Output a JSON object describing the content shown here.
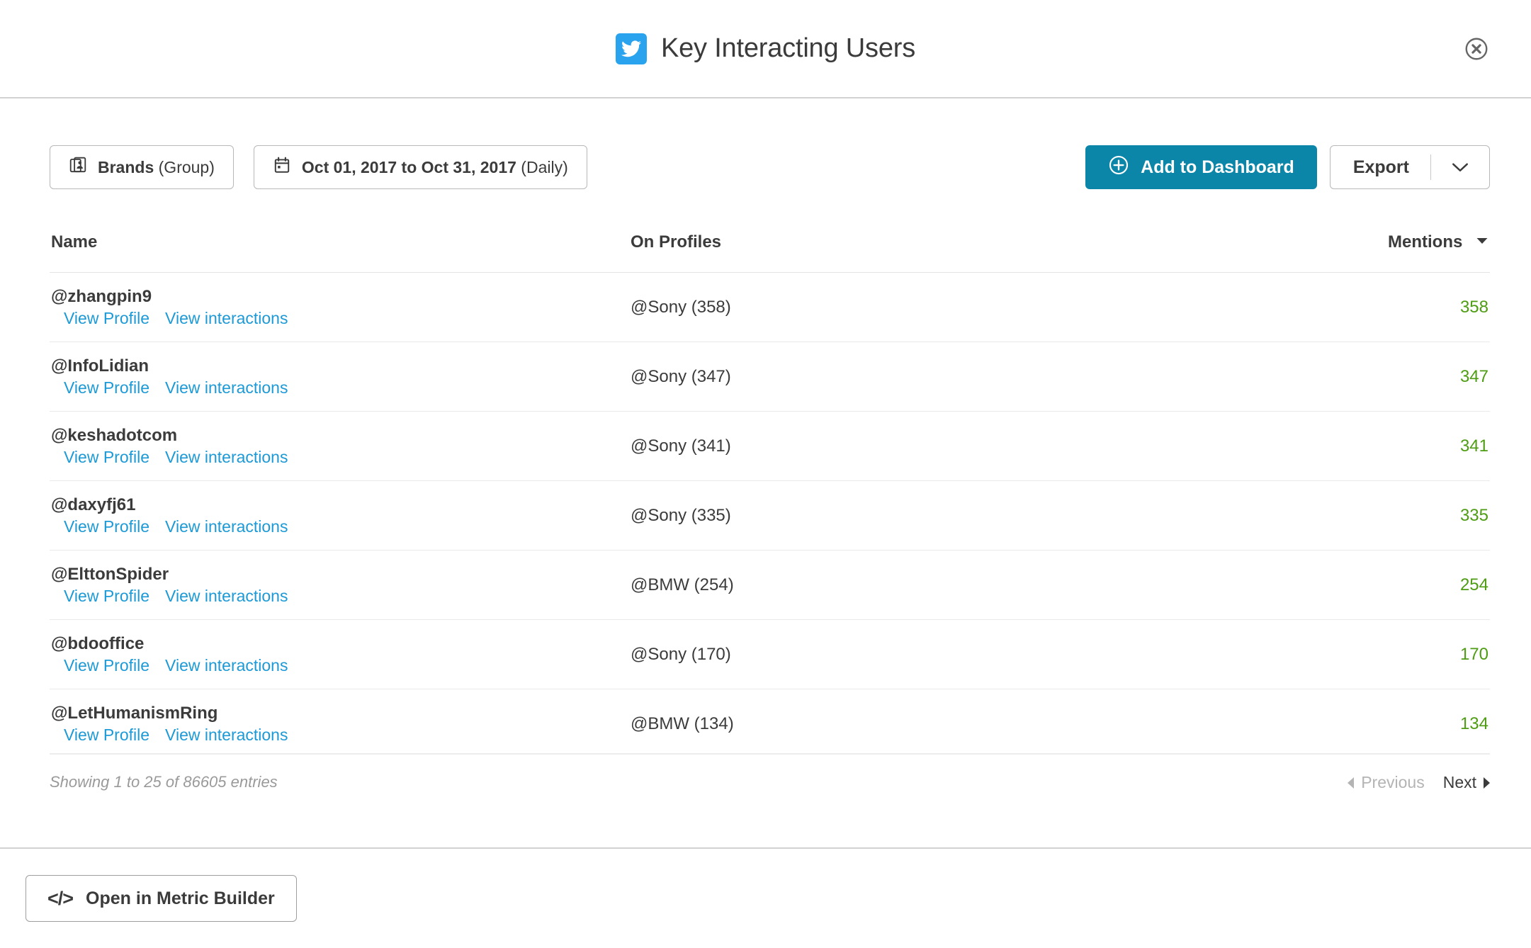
{
  "header": {
    "title": "Key Interacting Users",
    "network_icon": "twitter-icon",
    "close_icon": "close-circle-icon"
  },
  "toolbar": {
    "brand_filter": {
      "label_strong": "Brands",
      "label_light": "(Group)",
      "icon": "brands-card-icon"
    },
    "date_filter": {
      "label_strong": "Oct 01, 2017 to Oct 31, 2017",
      "label_light": "(Daily)",
      "icon": "calendar-icon"
    },
    "add_to_dashboard": {
      "label": "Add to Dashboard",
      "icon": "plus-circle-icon",
      "color": "#0c86a8"
    },
    "export": {
      "label": "Export",
      "caret_icon": "chevron-down-icon"
    }
  },
  "table": {
    "columns": {
      "name": "Name",
      "profiles": "On Profiles",
      "mentions": "Mentions"
    },
    "sort": {
      "column": "Mentions",
      "direction": "desc",
      "icon": "caret-down-icon"
    },
    "link_labels": {
      "profile": "View Profile",
      "interactions": "View interactions"
    },
    "link_color": "#1d9ad6",
    "mentions_color": "#4e9c13",
    "rows": [
      {
        "name": "@zhangpin9",
        "profiles": "@Sony (358)",
        "mentions": "358"
      },
      {
        "name": "@InfoLidian",
        "profiles": "@Sony (347)",
        "mentions": "347"
      },
      {
        "name": "@keshadotcom",
        "profiles": "@Sony (341)",
        "mentions": "341"
      },
      {
        "name": "@daxyfj61",
        "profiles": "@Sony (335)",
        "mentions": "335"
      },
      {
        "name": "@ElttonSpider",
        "profiles": "@BMW (254)",
        "mentions": "254"
      },
      {
        "name": "@bdooffice",
        "profiles": "@Sony (170)",
        "mentions": "170"
      },
      {
        "name": "@LetHumanismRing",
        "profiles": "@BMW (134)",
        "mentions": "134"
      }
    ]
  },
  "footer": {
    "entries_info": "Showing 1 to 25 of 86605 entries",
    "previous": "Previous",
    "next": "Next"
  },
  "bottom_bar": {
    "metric_builder": {
      "label": "Open in Metric Builder",
      "glyph": "</>"
    }
  }
}
